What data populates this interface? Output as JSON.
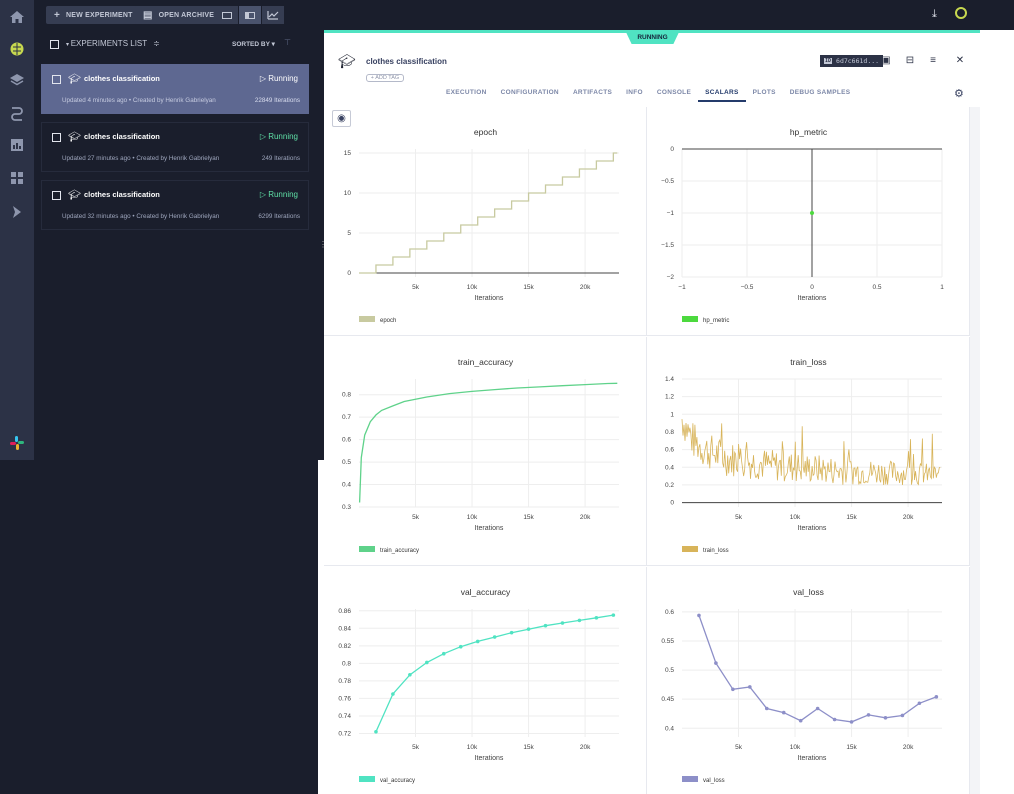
{
  "colors": {
    "accent": "#50e3c2",
    "nav_bg": "#2c3246",
    "bg_dark": "#1a1e2c",
    "selected_row": "#5e6891",
    "running_green": "#5fe0a6"
  },
  "toolbar": {
    "new_experiment": "NEW EXPERIMENT",
    "open_archive": "OPEN ARCHIVE"
  },
  "list": {
    "title": "EXPERIMENTS LIST",
    "sort_label": "SORTED BY",
    "items": [
      {
        "name": "clothes classification",
        "status": "▷ Running",
        "meta": "Updated 4 minutes ago  •  Created by Henrik Gabrielyan",
        "iterations": "22849 Iterations"
      },
      {
        "name": "clothes classification",
        "status": "▷ Running",
        "meta": "Updated 27 minutes ago  •  Created by Henrik Gabrielyan",
        "iterations": "249 Iterations"
      },
      {
        "name": "clothes classification",
        "status": "▷ Running",
        "meta": "Updated 32 minutes ago  •  Created by Henrik Gabrielyan",
        "iterations": "6299 Iterations"
      }
    ]
  },
  "detail": {
    "status_tag": "RUNNING",
    "name": "clothes classification",
    "add_tag": "+ ADD TAG",
    "id_badge": "ID",
    "id_value": "6d7c661d...",
    "tabs": [
      "EXECUTION",
      "CONFIGURATION",
      "ARTIFACTS",
      "INFO",
      "CONSOLE",
      "SCALARS",
      "PLOTS",
      "DEBUG SAMPLES"
    ],
    "active_tab": "SCALARS"
  },
  "chart_data": [
    {
      "id": "epoch",
      "type": "line",
      "title": "epoch",
      "xlabel": "Iterations",
      "xlim": [
        0,
        23000
      ],
      "ylim": [
        -0.5,
        15.5
      ],
      "yticks": [
        0,
        5,
        10,
        15
      ],
      "xticks": [
        5000,
        10000,
        15000,
        20000
      ],
      "xtick_labels": [
        "5k",
        "10k",
        "15k",
        "20k"
      ],
      "color": "#c8caa0",
      "step": true,
      "series": [
        {
          "name": "epoch",
          "x": [
            1500,
            3000,
            4500,
            6000,
            7500,
            9000,
            10500,
            12000,
            13500,
            15000,
            16500,
            18000,
            19500,
            21000,
            22500,
            22849
          ],
          "y": [
            1,
            2,
            3,
            4,
            5,
            6,
            7,
            8,
            9,
            10,
            11,
            12,
            13,
            14,
            15,
            15
          ]
        }
      ]
    },
    {
      "id": "hp_metric",
      "type": "scatter",
      "title": "hp_metric",
      "xlabel": "Iterations",
      "xlim": [
        -1,
        1
      ],
      "ylim": [
        -2,
        0
      ],
      "yticks": [
        0,
        -0.5,
        -1,
        -1.5,
        -2
      ],
      "ytick_labels": [
        "0",
        "−0.5",
        "−1",
        "−1.5",
        "−2"
      ],
      "xticks": [
        -1,
        -0.5,
        0,
        0.5,
        1
      ],
      "xtick_labels": [
        "−1",
        "−0.5",
        "0",
        "0.5",
        "1"
      ],
      "color": "#4cd93e",
      "zero_x_line": true,
      "series": [
        {
          "name": "hp_metric",
          "x": [
            0
          ],
          "y": [
            -1
          ]
        }
      ]
    },
    {
      "id": "train_accuracy",
      "type": "line",
      "title": "train_accuracy",
      "xlabel": "Iterations",
      "xlim": [
        0,
        23000
      ],
      "ylim": [
        0.3,
        0.87
      ],
      "yticks": [
        0.3,
        0.4,
        0.5,
        0.6,
        0.7,
        0.8
      ],
      "xticks": [
        5000,
        10000,
        15000,
        20000
      ],
      "xtick_labels": [
        "5k",
        "10k",
        "15k",
        "20k"
      ],
      "color": "#5fd28a",
      "series": [
        {
          "name": "train_accuracy",
          "x": [
            50,
            200,
            500,
            1000,
            1500,
            2000,
            3000,
            4000,
            5000,
            6000,
            8000,
            10000,
            12000,
            14000,
            16000,
            18000,
            20000,
            22000,
            22849
          ],
          "y": [
            0.32,
            0.52,
            0.62,
            0.68,
            0.71,
            0.73,
            0.75,
            0.77,
            0.78,
            0.79,
            0.805,
            0.815,
            0.823,
            0.83,
            0.835,
            0.84,
            0.845,
            0.85,
            0.851
          ]
        }
      ]
    },
    {
      "id": "train_loss",
      "type": "line",
      "title": "train_loss",
      "xlabel": "Iterations",
      "xlim": [
        0,
        23000
      ],
      "ylim": [
        -0.05,
        1.4
      ],
      "yticks": [
        0,
        0.2,
        0.4,
        0.6,
        0.8,
        1,
        1.2,
        1.4
      ],
      "xticks": [
        5000,
        10000,
        15000,
        20000
      ],
      "xtick_labels": [
        "5k",
        "10k",
        "15k",
        "20k"
      ],
      "color": "#d8b45a",
      "noisy": true,
      "series": [
        {
          "name": "train_loss",
          "x": [
            0,
            1000,
            2000,
            3000,
            4000,
            5000,
            6000,
            7000,
            8000,
            9000,
            10000,
            12000,
            14000,
            16000,
            18000,
            20000,
            22000,
            22849
          ],
          "y": [
            0.95,
            0.7,
            0.6,
            0.55,
            0.5,
            0.48,
            0.46,
            0.44,
            0.42,
            0.41,
            0.4,
            0.38,
            0.36,
            0.35,
            0.34,
            0.33,
            0.32,
            0.32
          ]
        }
      ]
    },
    {
      "id": "val_accuracy",
      "type": "line",
      "title": "val_accuracy",
      "xlabel": "Iterations",
      "xlim": [
        0,
        23000
      ],
      "ylim": [
        0.716,
        0.862
      ],
      "yticks": [
        0.72,
        0.74,
        0.76,
        0.78,
        0.8,
        0.82,
        0.84,
        0.86
      ],
      "xticks": [
        5000,
        10000,
        15000,
        20000
      ],
      "xtick_labels": [
        "5k",
        "10k",
        "15k",
        "20k"
      ],
      "color": "#50e3c2",
      "markers": true,
      "series": [
        {
          "name": "val_accuracy",
          "x": [
            1500,
            3000,
            4500,
            6000,
            7500,
            9000,
            10500,
            12000,
            13500,
            15000,
            16500,
            18000,
            19500,
            21000,
            22500
          ],
          "y": [
            0.722,
            0.765,
            0.787,
            0.801,
            0.811,
            0.819,
            0.825,
            0.83,
            0.835,
            0.839,
            0.843,
            0.846,
            0.849,
            0.852,
            0.855
          ]
        }
      ]
    },
    {
      "id": "val_loss",
      "type": "line",
      "title": "val_loss",
      "xlabel": "Iterations",
      "xlim": [
        0,
        23000
      ],
      "ylim": [
        0.385,
        0.605
      ],
      "yticks": [
        0.4,
        0.45,
        0.5,
        0.55,
        0.6
      ],
      "xticks": [
        5000,
        10000,
        15000,
        20000
      ],
      "xtick_labels": [
        "5k",
        "10k",
        "15k",
        "20k"
      ],
      "color": "#8d8fc8",
      "markers": true,
      "series": [
        {
          "name": "val_loss",
          "x": [
            1500,
            3000,
            4500,
            6000,
            7500,
            9000,
            10500,
            12000,
            13500,
            15000,
            16500,
            18000,
            19500,
            21000,
            22500
          ],
          "y": [
            0.594,
            0.512,
            0.467,
            0.471,
            0.434,
            0.427,
            0.413,
            0.434,
            0.415,
            0.411,
            0.423,
            0.418,
            0.422,
            0.443,
            0.454
          ]
        }
      ]
    }
  ]
}
